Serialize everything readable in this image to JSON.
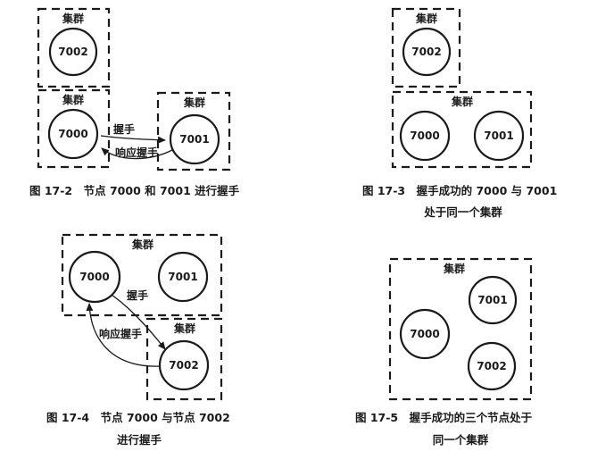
{
  "fig2": {
    "cluster_a_label": "集群",
    "cluster_b_label": "集群",
    "cluster_c_label": "集群",
    "node_7002": "7002",
    "node_7000": "7000",
    "node_7001": "7001",
    "handshake": "握手",
    "response": "响应握手",
    "caption": "图 17-2　节点 7000 和 7001 进行握手"
  },
  "fig3": {
    "cluster_a_label": "集群",
    "cluster_b_label": "集群",
    "node_7002": "7002",
    "node_7000": "7000",
    "node_7001": "7001",
    "caption_line1": "图 17-3　握手成功的 7000 与 7001",
    "caption_line2": "处于同一个集群"
  },
  "fig4": {
    "cluster_a_label": "集群",
    "cluster_b_label": "集群",
    "node_7000": "7000",
    "node_7001": "7001",
    "node_7002": "7002",
    "handshake": "握手",
    "response": "响应握手",
    "caption_line1": "图 17-4　节点 7000 与节点 7002",
    "caption_line2": "进行握手"
  },
  "fig5": {
    "cluster_label": "集群",
    "node_7000": "7000",
    "node_7001": "7001",
    "node_7002": "7002",
    "caption_line1": "图 17-5　握手成功的三个节点处于",
    "caption_line2": "同一个集群"
  }
}
